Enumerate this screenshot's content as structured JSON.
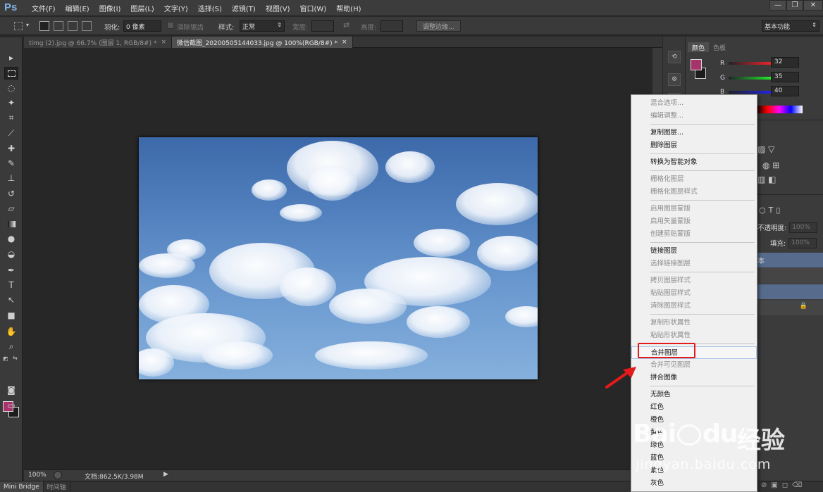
{
  "app": {
    "logo": "Ps"
  },
  "menubar": {
    "items": [
      "文件(F)",
      "编辑(E)",
      "图像(I)",
      "图层(L)",
      "文字(Y)",
      "选择(S)",
      "滤镜(T)",
      "视图(V)",
      "窗口(W)",
      "帮助(H)"
    ]
  },
  "window_controls": {
    "minimize": "—",
    "restore": "❐",
    "close": "✕"
  },
  "options_bar": {
    "feather_label": "羽化:",
    "feather_value": "0 像素",
    "antialias_label": "消除锯齿",
    "style_label": "样式:",
    "style_value": "正常",
    "width_label": "宽度:",
    "height_label": "高度:",
    "refine_edge_button": "调整边缘...",
    "workspace_value": "基本功能"
  },
  "tabs": [
    {
      "label": "timg (2).jpg @ 66.7% (图层 1, RGB/8#) *",
      "close": "×",
      "active": false
    },
    {
      "label": "微信截图_20200505144033.jpg @ 100%(RGB/8#) *",
      "close": "×",
      "active": true
    }
  ],
  "status_bar": {
    "zoom": "100%",
    "doc_info": "文档:862.5K/3.98M"
  },
  "bottom_tabs": [
    "Mini Bridge",
    "时间轴"
  ],
  "color_panel": {
    "tabs": [
      "颜色",
      "色板"
    ],
    "sliders": [
      {
        "label": "R",
        "value": "32"
      },
      {
        "label": "G",
        "value": "35"
      },
      {
        "label": "B",
        "value": "40"
      }
    ],
    "foreground": "#a8336b",
    "background": "#1c1c1c"
  },
  "layers_panel": {
    "opacity_label": "不透明度:",
    "opacity_value": "100%",
    "fill_label": "填充:",
    "fill_value": "100%",
    "layer_name_partial": "本"
  },
  "context_menu": {
    "items": [
      {
        "label": "混合选项...",
        "enabled": false
      },
      {
        "label": "编辑调整...",
        "enabled": false
      },
      {
        "sep": true
      },
      {
        "label": "复制图层...",
        "enabled": true
      },
      {
        "label": "删除图层",
        "enabled": true
      },
      {
        "sep": true
      },
      {
        "label": "转换为智能对象",
        "enabled": true
      },
      {
        "sep": true
      },
      {
        "label": "栅格化图层",
        "enabled": false
      },
      {
        "label": "栅格化图层样式",
        "enabled": false
      },
      {
        "sep": true
      },
      {
        "label": "启用图层蒙版",
        "enabled": false
      },
      {
        "label": "启用矢量蒙版",
        "enabled": false
      },
      {
        "label": "创建剪贴蒙版",
        "enabled": false
      },
      {
        "sep": true
      },
      {
        "label": "链接图层",
        "enabled": true
      },
      {
        "label": "选择链接图层",
        "enabled": false
      },
      {
        "sep": true
      },
      {
        "label": "拷贝图层样式",
        "enabled": false
      },
      {
        "label": "粘贴图层样式",
        "enabled": false
      },
      {
        "label": "清除图层样式",
        "enabled": false
      },
      {
        "sep": true
      },
      {
        "label": "复制形状属性",
        "enabled": false
      },
      {
        "label": "粘贴形状属性",
        "enabled": false
      },
      {
        "sep": true
      },
      {
        "label": "合并图层",
        "enabled": true,
        "highlighted": true
      },
      {
        "label": "合并可见图层",
        "enabled": false
      },
      {
        "label": "拼合图像",
        "enabled": true
      },
      {
        "sep": true
      },
      {
        "label": "无颜色",
        "enabled": true
      },
      {
        "label": "红色",
        "enabled": true
      },
      {
        "label": "橙色",
        "enabled": true
      },
      {
        "label": "黄色",
        "enabled": true
      },
      {
        "label": "绿色",
        "enabled": true
      },
      {
        "label": "蓝色",
        "enabled": true
      },
      {
        "label": "紫色",
        "enabled": true
      },
      {
        "label": "灰色",
        "enabled": true
      }
    ]
  },
  "watermark": {
    "brand": "Bai",
    "brand_suffix": "du",
    "product": "经验",
    "url": "jingyan.baidu.com"
  },
  "annotation": {
    "highlight_color": "#e41b1b"
  }
}
